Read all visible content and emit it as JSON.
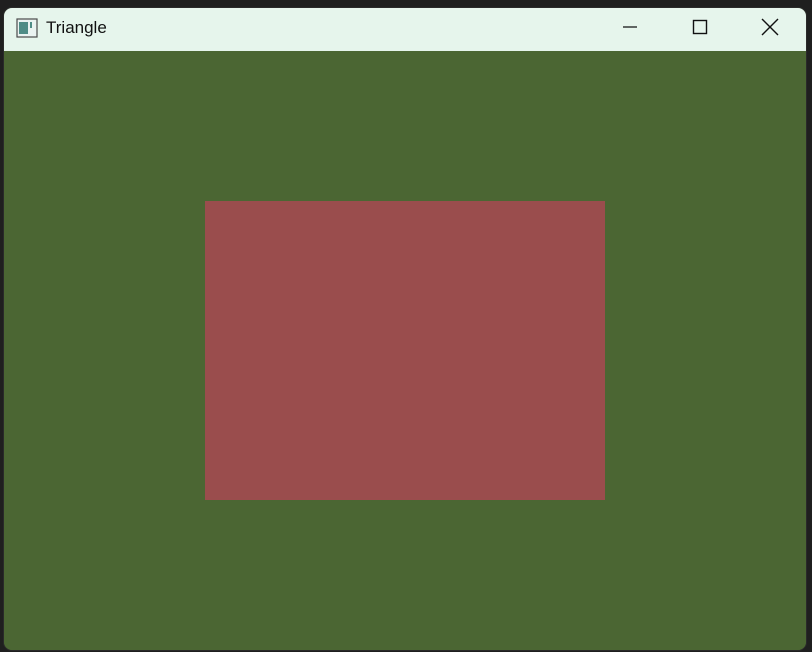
{
  "window": {
    "title": "Triangle",
    "titlebar_color": "#e6f5ec",
    "clear_color": "#4b6633",
    "icons": {
      "app": "app-window-icon",
      "minimize": "minimize-icon",
      "maximize": "maximize-icon",
      "close": "close-icon"
    }
  },
  "scene": {
    "shape_color": "#9a4d4d"
  }
}
